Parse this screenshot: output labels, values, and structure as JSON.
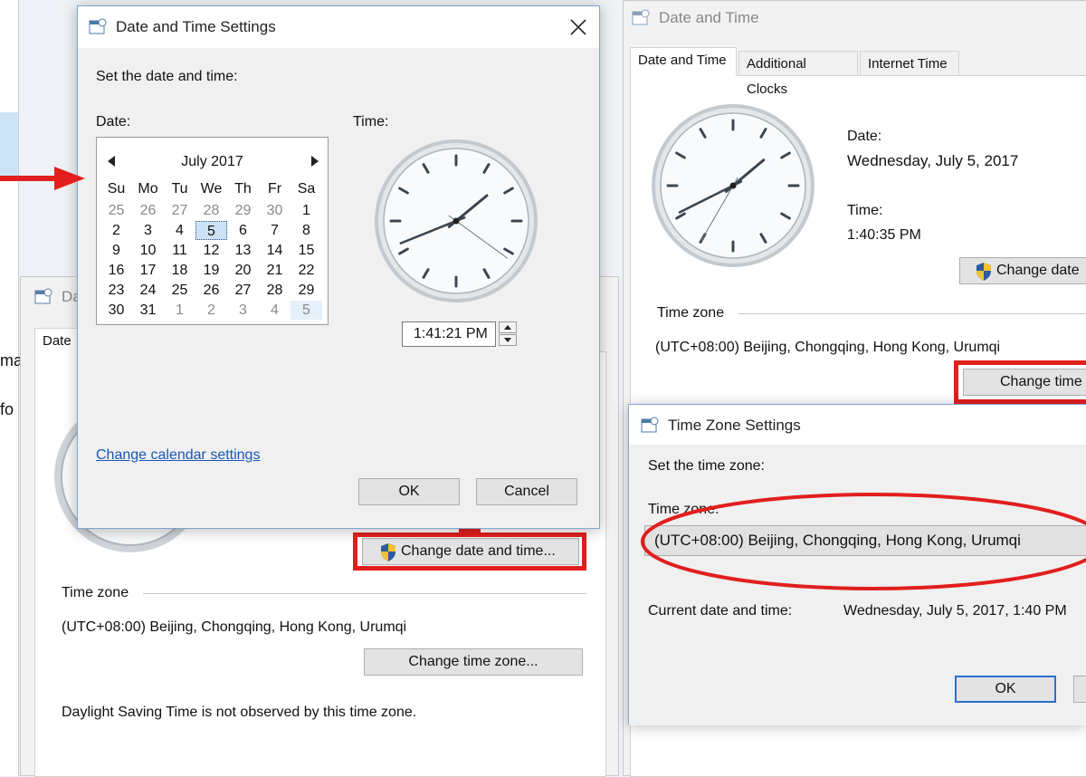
{
  "main_dialog": {
    "title": "Date and Time Settings",
    "instruction": "Set the date and time:",
    "date_label": "Date:",
    "time_label": "Time:",
    "calendar": {
      "month": "July 2017",
      "weekdays": [
        "Su",
        "Mo",
        "Tu",
        "We",
        "Th",
        "Fr",
        "Sa"
      ],
      "days": [
        [
          "25",
          "26",
          "27",
          "28",
          "29",
          "30",
          "1"
        ],
        [
          "2",
          "3",
          "4",
          "5",
          "6",
          "7",
          "8"
        ],
        [
          "9",
          "10",
          "11",
          "12",
          "13",
          "14",
          "15"
        ],
        [
          "16",
          "17",
          "18",
          "19",
          "20",
          "21",
          "22"
        ],
        [
          "23",
          "24",
          "25",
          "26",
          "27",
          "28",
          "29"
        ],
        [
          "30",
          "31",
          "1",
          "2",
          "3",
          "4",
          "5"
        ]
      ],
      "selected_day": "5"
    },
    "time_value": "1:41:21 PM",
    "change_calendar_link": "Change calendar settings",
    "ok": "OK",
    "cancel": "Cancel",
    "clock": {
      "hour": 1,
      "minute": 41,
      "second": 21
    }
  },
  "left_window": {
    "title_fragment": "Da",
    "tab_fragment": "Date",
    "change_datetime_button": "Change date and time...",
    "time_zone_group": "Time zone",
    "time_zone_value": "(UTC+08:00) Beijing, Chongqing, Hong Kong, Urumqi",
    "change_timezone_button": "Change time zone...",
    "dst_note": "Daylight Saving Time is not observed by this time zone."
  },
  "edge_fragments": {
    "line1": "ma",
    "line2": "fo"
  },
  "right_window": {
    "title": "Date and Time",
    "tabs": [
      "Date and Time",
      "Additional Clocks",
      "Internet Time"
    ],
    "date_label": "Date:",
    "date_value": "Wednesday, July 5, 2017",
    "time_label": "Time:",
    "time_value": "1:40:35 PM",
    "change_date_button": "Change date",
    "time_zone_group": "Time zone",
    "time_zone_value": "(UTC+08:00) Beijing, Chongqing, Hong Kong, Urumqi",
    "change_time_button": "Change time",
    "clock": {
      "hour": 1,
      "minute": 40,
      "second": 35
    }
  },
  "tz_dialog": {
    "title": "Time Zone Settings",
    "instruction": "Set the time zone:",
    "time_zone_label": "Time zone:",
    "time_zone_value": "(UTC+08:00) Beijing, Chongqing, Hong Kong, Urumqi",
    "current_label": "Current date and time:",
    "current_value": "Wednesday, July 5, 2017, 1:40 PM",
    "ok": "OK"
  },
  "colors": {
    "annotation_red": "#e21e1e",
    "link_blue": "#1a56b8",
    "focus_blue": "#2b6fd0"
  }
}
